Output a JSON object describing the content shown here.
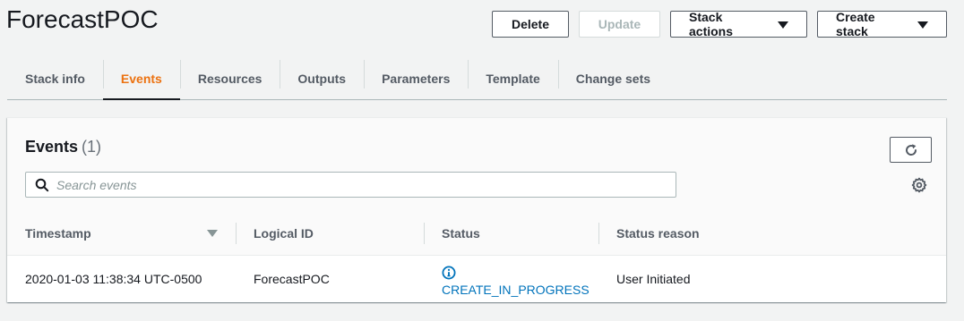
{
  "header": {
    "title": "ForecastPOC",
    "buttons": {
      "delete": "Delete",
      "update": "Update",
      "stack_actions": "Stack actions",
      "create_stack": "Create stack"
    }
  },
  "tabs": [
    {
      "label": "Stack info",
      "active": false
    },
    {
      "label": "Events",
      "active": true
    },
    {
      "label": "Resources",
      "active": false
    },
    {
      "label": "Outputs",
      "active": false
    },
    {
      "label": "Parameters",
      "active": false
    },
    {
      "label": "Template",
      "active": false
    },
    {
      "label": "Change sets",
      "active": false
    }
  ],
  "events_panel": {
    "title": "Events",
    "count": "(1)",
    "search": {
      "placeholder": "Search events",
      "value": ""
    },
    "columns": {
      "timestamp": "Timestamp",
      "logical_id": "Logical ID",
      "status": "Status",
      "status_reason": "Status reason"
    },
    "rows": [
      {
        "timestamp": "2020-01-03 11:38:34 UTC-0500",
        "logical_id": "ForecastPOC",
        "status": "CREATE_IN_PROGRESS",
        "status_icon": "info-icon",
        "status_reason": "User Initiated"
      }
    ]
  },
  "colors": {
    "accent_active_tab": "#ec7211",
    "status_link": "#0073bb",
    "text_primary": "#16191f",
    "text_secondary": "#545b64"
  }
}
